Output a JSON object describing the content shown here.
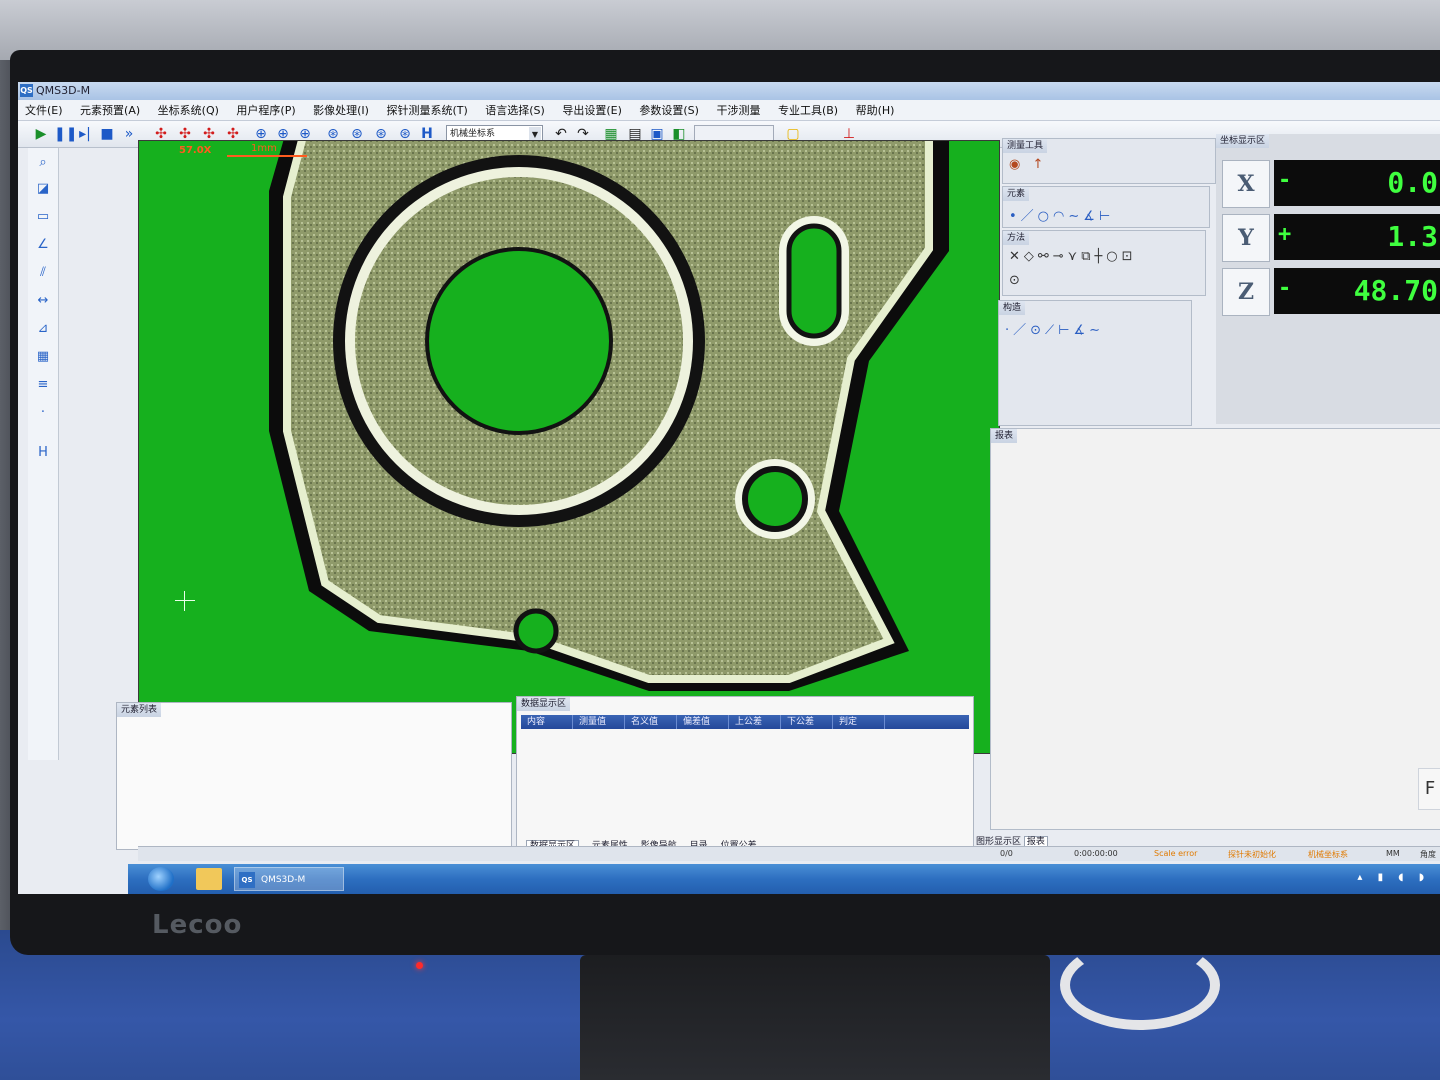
{
  "window": {
    "title": "QMS3D-M",
    "app_icon": "QS"
  },
  "menu": [
    "文件(E)",
    "元素预置(A)",
    "坐标系统(Q)",
    "用户程序(P)",
    "影像处理(I)",
    "探针测量系统(T)",
    "语言选择(S)",
    "导出设置(E)",
    "参数设置(S)",
    "干涉测量",
    "专业工具(B)",
    "帮助(H)"
  ],
  "toolbar": {
    "coordinate_system": "机械坐标系"
  },
  "camera": {
    "magnification_label": "57.0X",
    "scale_label": "1mm"
  },
  "panels": {
    "measure_tools": "测量工具",
    "elements": "元素",
    "methods": "方法",
    "construct": "构造",
    "coord_display": "坐标显示区",
    "report": "报表",
    "element_list": "元素列表",
    "data_display": "数据显示区"
  },
  "dro": [
    {
      "axis": "X",
      "sign": "-",
      "value": "0.0"
    },
    {
      "axis": "Y",
      "sign": "+",
      "value": "1.3"
    },
    {
      "axis": "Z",
      "sign": "-",
      "value": "48.70"
    }
  ],
  "data_grid": {
    "columns": [
      "内容",
      "测量值",
      "名义值",
      "偏差值",
      "上公差",
      "下公差",
      "判定"
    ]
  },
  "data_tabs": [
    "数据显示区",
    "元素属性",
    "影像导航",
    "目录",
    "位置公差"
  ],
  "right_tabs": [
    "图形显示区",
    "报表"
  ],
  "side_button": "F",
  "statusbar": {
    "count": "0/0",
    "time": "0:00:00:00",
    "scale": "Scale error",
    "probe_status": "探针未初始化",
    "coord": "机械坐标系",
    "unit": "MM",
    "angle": "角度"
  },
  "taskbar": {
    "app_label": "QMS3D-M"
  },
  "monitor_brand": "Lecoo"
}
